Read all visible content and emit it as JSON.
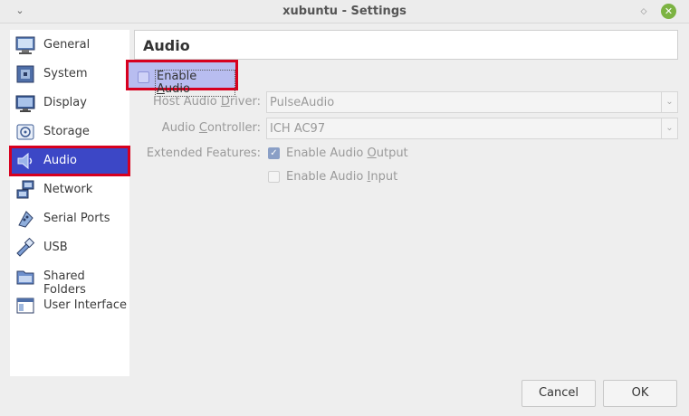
{
  "window": {
    "title": "xubuntu - Settings",
    "menu_icon": "chevron-down-icon",
    "restore_icon": "restore-icon",
    "close_icon": "close-icon",
    "close_color": "#7cb342"
  },
  "sidebar": {
    "items": [
      {
        "label": "General",
        "icon": "general-icon"
      },
      {
        "label": "System",
        "icon": "system-icon"
      },
      {
        "label": "Display",
        "icon": "display-icon"
      },
      {
        "label": "Storage",
        "icon": "storage-icon"
      },
      {
        "label": "Audio",
        "icon": "audio-icon",
        "selected": true
      },
      {
        "label": "Network",
        "icon": "network-icon"
      },
      {
        "label": "Serial Ports",
        "icon": "serial-ports-icon"
      },
      {
        "label": "USB",
        "icon": "usb-icon"
      },
      {
        "label": "Shared Folders",
        "icon": "shared-folders-icon"
      },
      {
        "label": "User Interface",
        "icon": "user-interface-icon"
      }
    ],
    "selected_color": "#3c47c6"
  },
  "page": {
    "title": "Audio",
    "enable_audio": {
      "label_pre": "Enable ",
      "label_accel": "A",
      "label_post": "udio",
      "checked": false
    },
    "host_driver": {
      "label_pre": "Host Audio ",
      "label_accel": "D",
      "label_post": "river:",
      "value": "PulseAudio"
    },
    "controller": {
      "label_pre": "Audio ",
      "label_accel": "C",
      "label_post": "ontroller:",
      "value": "ICH AC97"
    },
    "extended": {
      "label": "Extended Features:",
      "output": {
        "label_pre": "Enable Audio ",
        "label_accel": "O",
        "label_post": "utput",
        "checked": true
      },
      "input": {
        "label_pre": "Enable Audio ",
        "label_accel": "I",
        "label_post": "nput",
        "checked": false
      }
    }
  },
  "buttons": {
    "cancel": "Cancel",
    "ok": "OK"
  },
  "colors": {
    "highlight_border": "#d7001f",
    "checkbox_highlight": "#b8bdf0"
  }
}
